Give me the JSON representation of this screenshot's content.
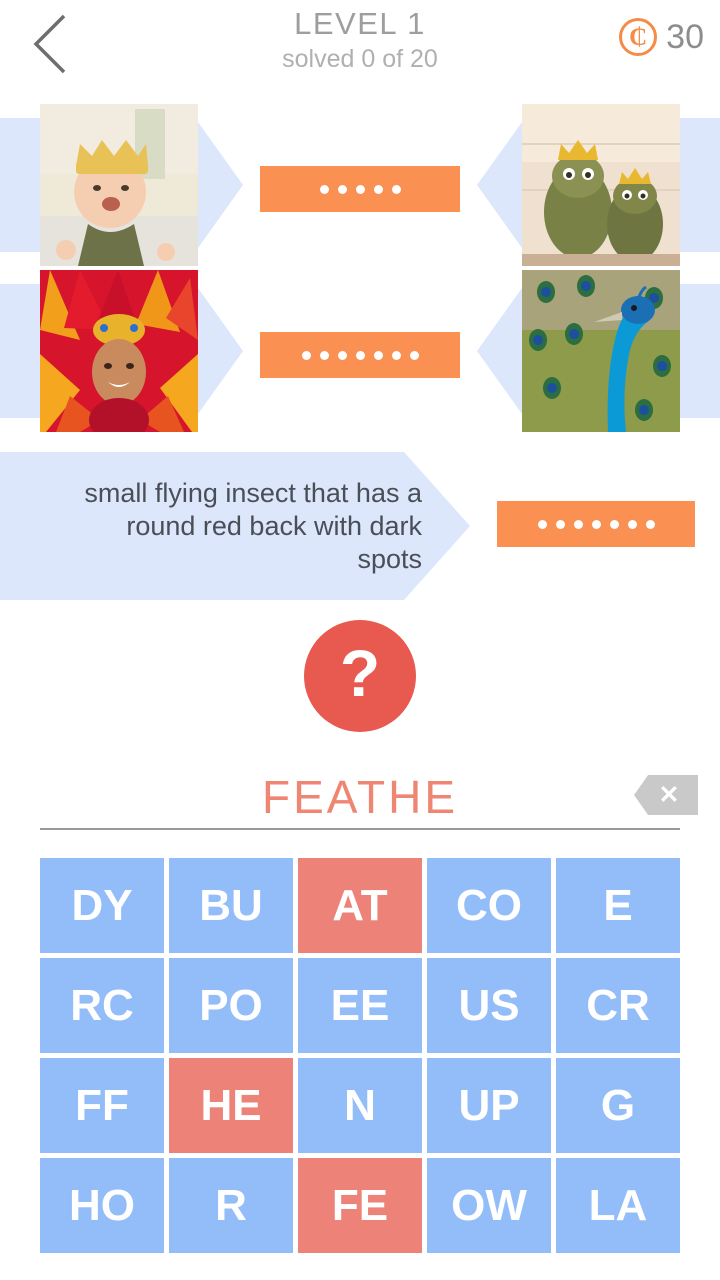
{
  "header": {
    "back_icon": "chevron-left-icon",
    "title": "LEVEL 1",
    "subtitle": "solved 0 of 20",
    "coin_icon": "coin-icon",
    "coin_glyph": "₵",
    "coin_count": "30"
  },
  "colors": {
    "orange": "#fa9052",
    "light_blue": "#dce7fb",
    "tile_blue": "#92bdf9",
    "tile_used_red": "#ed8278",
    "hint_red": "#e8594f",
    "word_red": "#ef8573",
    "gray_text": "#9e9e9e"
  },
  "puzzles": [
    {
      "type": "image-pair",
      "left_image_alt": "baby wearing yellow knitted crown",
      "right_image_alt": "two frog statues wearing gold crowns",
      "answer_length": 5,
      "solved": false
    },
    {
      "type": "image-pair",
      "left_image_alt": "carnival dancer in red and orange feather headdress",
      "right_image_alt": "peacock with blue neck and green feathers",
      "answer_length": 7,
      "solved": false
    },
    {
      "type": "text-clue",
      "clue": "small flying insect that has a round red back with dark spots",
      "answer_length": 7,
      "solved": false
    }
  ],
  "hint_button": {
    "label": "?",
    "icon": "question-mark-icon"
  },
  "word_input": {
    "current_word": "FEATHE",
    "backspace_icon": "backspace-icon",
    "backspace_glyph": "✕"
  },
  "tile_grid": {
    "columns": 5,
    "rows": 4,
    "tiles": [
      {
        "label": "DY",
        "used": false
      },
      {
        "label": "BU",
        "used": false
      },
      {
        "label": "AT",
        "used": true
      },
      {
        "label": "CO",
        "used": false
      },
      {
        "label": "E",
        "used": false
      },
      {
        "label": "RC",
        "used": false
      },
      {
        "label": "PO",
        "used": false
      },
      {
        "label": "EE",
        "used": false
      },
      {
        "label": "US",
        "used": false
      },
      {
        "label": "CR",
        "used": false
      },
      {
        "label": "FF",
        "used": false
      },
      {
        "label": "HE",
        "used": true
      },
      {
        "label": "N",
        "used": false
      },
      {
        "label": "UP",
        "used": false
      },
      {
        "label": "G",
        "used": false
      },
      {
        "label": "HO",
        "used": false
      },
      {
        "label": "R",
        "used": false
      },
      {
        "label": "FE",
        "used": true
      },
      {
        "label": "OW",
        "used": false
      },
      {
        "label": "LA",
        "used": false
      }
    ]
  }
}
